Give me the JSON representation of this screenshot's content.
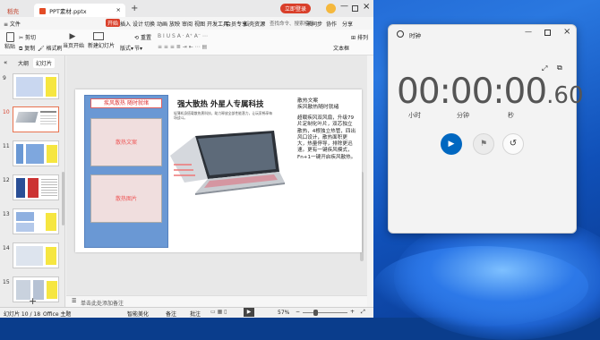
{
  "wps": {
    "tabs": [
      {
        "label": "稻壳"
      },
      {
        "label": "PPT素材.pptx"
      }
    ],
    "titlebar_right": {
      "login": "立即登录"
    },
    "menu": [
      "≡ 文件",
      "开始",
      "插入",
      "设计",
      "切换",
      "动画",
      "放映",
      "审阅",
      "视图",
      "开发工具",
      "会员专享",
      "稻壳资源"
    ],
    "menu_right": {
      "search": "查找命令、搜索模板",
      "sync": "未同步",
      "collab": "协作",
      "share": "分享"
    },
    "toolbar": {
      "cut": "剪切",
      "paste": "粘贴",
      "copy": "复制",
      "format_painter": "格式刷",
      "current_slide": "当页开始",
      "new_slide": "新建幻灯片",
      "layout": "版式",
      "section": "节",
      "reset": "重置",
      "textbox": "文本框",
      "arrange": "排列"
    },
    "panel_tabs": {
      "outline": "大纲",
      "slides": "幻灯片"
    },
    "slide_numbers": [
      "9",
      "10",
      "11",
      "12",
      "13",
      "14",
      "15"
    ],
    "slide": {
      "left_header": "疾风散热 随时就绪",
      "box1": "散热文案",
      "box2": "散热图片",
      "title": "强大散热 外星人专属科技",
      "subtitle": "轻薄机身搭载散热黑科技，助力释放全部性能潜力，让玩家畅享每场战斗。",
      "right_title1": "疾风散热",
      "right_title2": "随时就绪",
      "right_body": "超载疾风双风扇，升级79片定制化叶片，双芯独立散热，4根独立热管，四出风口设计，散热面积更大，热量停导，排除更迅速。更有一键疾风模式，Fn+1一键开启疾风散热。",
      "right_label": "散热文案"
    },
    "notes_placeholder": "单击此处添加备注",
    "status": {
      "slide_info": "幻灯片 10 / 18",
      "theme": "Office 主题",
      "beautify": "智能美化",
      "notes": "备注",
      "comment": "批注",
      "zoom": "57%"
    }
  },
  "clock": {
    "title": "时钟",
    "time_main": "00:00:00",
    "time_frac": ".60",
    "labels": {
      "hours": "小时",
      "minutes": "分钟",
      "seconds": "秒"
    }
  },
  "colors": {
    "accent": "#0067c0",
    "wps_red": "#d93f2a",
    "slide_box": "#6a98d4",
    "box_inner": "#f0dede"
  }
}
